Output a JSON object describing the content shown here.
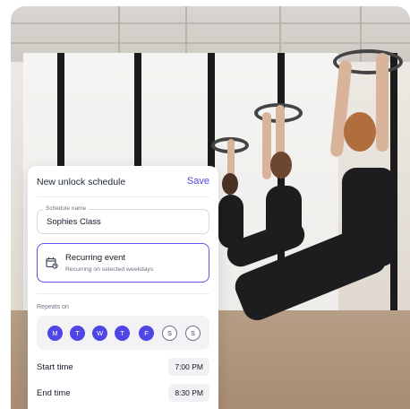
{
  "header": {
    "title": "New unlock schedule",
    "save_label": "Save"
  },
  "schedule_name": {
    "label": "Schedule name",
    "value": "Sophies Class"
  },
  "recurring": {
    "title": "Recurring event",
    "subtitle": "Recurring on selected weekdays",
    "icon": "calendar-repeat-icon",
    "selected": true
  },
  "repeats": {
    "label": "Repeats on",
    "days": [
      {
        "letter": "M",
        "selected": true
      },
      {
        "letter": "T",
        "selected": true
      },
      {
        "letter": "W",
        "selected": true
      },
      {
        "letter": "T",
        "selected": true
      },
      {
        "letter": "F",
        "selected": true
      },
      {
        "letter": "S",
        "selected": false
      },
      {
        "letter": "S",
        "selected": false
      }
    ]
  },
  "start_time": {
    "label": "Start time",
    "value": "7:00 PM"
  },
  "end_time": {
    "label": "End time",
    "value": "8:30 PM"
  },
  "colors": {
    "accent": "#4f46e5"
  }
}
